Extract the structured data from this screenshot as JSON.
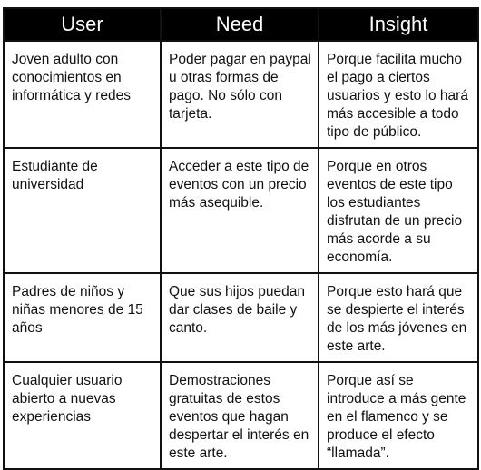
{
  "table": {
    "headers": [
      "User",
      "Need",
      "Insight"
    ],
    "rows": [
      {
        "user": "Joven adulto con conocimientos en informática y redes",
        "need": "Poder pagar en paypal u otras formas de pago. No sólo con tarjeta.",
        "insight": "Porque facilita mucho el pago a ciertos usuarios y esto lo hará más accesible a todo tipo de público."
      },
      {
        "user": "Estudiante de universidad",
        "need": "Acceder a este tipo de eventos con un precio más asequible.",
        "insight": "Porque en otros eventos de este tipo los estudiantes disfrutan de un precio más acorde a su economía."
      },
      {
        "user": "Padres de niños y niñas menores de 15 años",
        "need": "Que sus hijos puedan dar clases de baile y canto.",
        "insight": "Porque esto hará que se despierte el interés de los más jóvenes en este arte."
      },
      {
        "user": "Cualquier usuario abierto a nuevas experiencias",
        "need": "Demostraciones gratuitas de estos eventos que hagan despertar el interés en este arte.",
        "insight": "Porque así se introduce a más gente en el flamenco y se produce el efecto “llamada”."
      }
    ]
  },
  "colors": {
    "header_bg": "#000000",
    "header_text": "#ffffff",
    "border": "#111111",
    "cell_text": "#111111"
  }
}
